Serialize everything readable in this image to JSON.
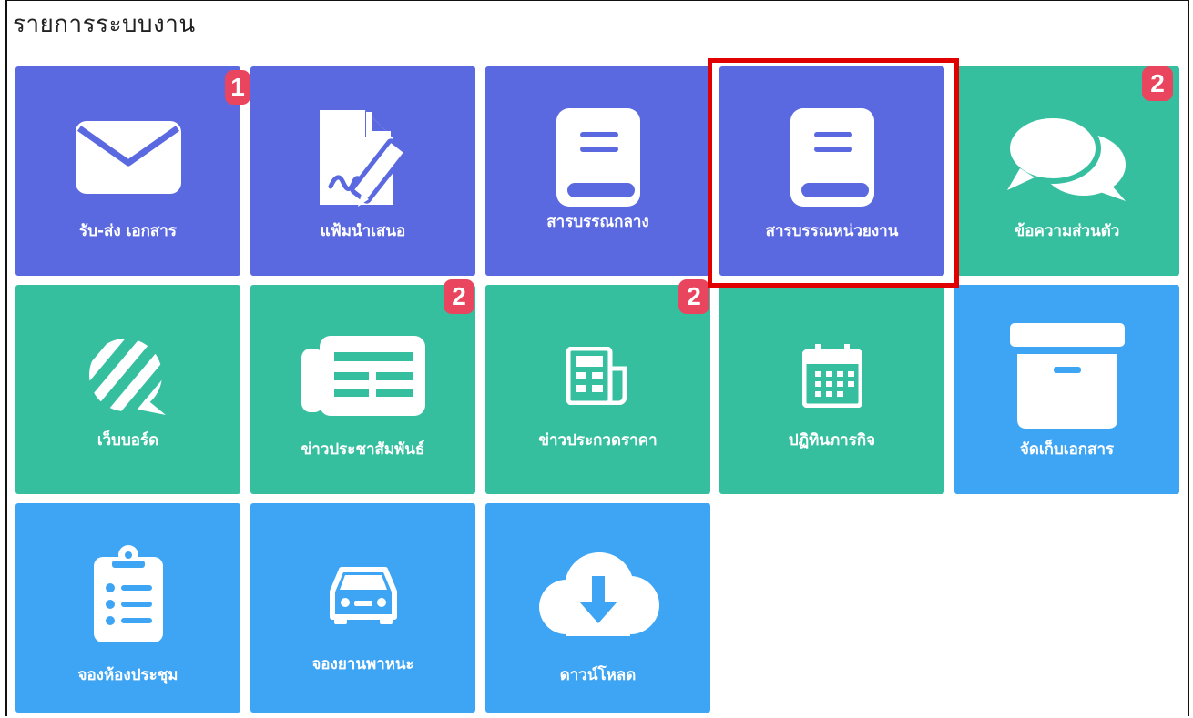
{
  "page": {
    "title": "รายการระบบงาน"
  },
  "colors": {
    "purple": "#5b69e0",
    "green": "#36bf9f",
    "blue": "#3ea5f5",
    "badge": "#e9455e",
    "highlight": "#e00000"
  },
  "tiles": [
    {
      "label": "รับ-ส่ง เอกสาร",
      "icon": "envelope-icon",
      "color": "purple",
      "badge": "1"
    },
    {
      "label": "แฟ้มนำเสนอ",
      "icon": "file-signature-icon",
      "color": "purple"
    },
    {
      "label": "สารบรรณกลาง",
      "icon": "book-icon",
      "color": "purple"
    },
    {
      "label": "สารบรรณหน่วยงาน",
      "icon": "book-icon",
      "color": "purple",
      "highlighted": true
    },
    {
      "label": "ข้อความส่วนตัว",
      "icon": "comments-icon",
      "color": "green",
      "badge": "2"
    },
    {
      "label": "เว็บบอร์ด",
      "icon": "webboard-icon",
      "color": "green"
    },
    {
      "label": "ข่าวประชาสัมพันธ์",
      "icon": "newspaper-icon",
      "color": "green",
      "badge": "2"
    },
    {
      "label": "ข่าวประกวดราคา",
      "icon": "newspaper-small-icon",
      "color": "green",
      "badge": "2"
    },
    {
      "label": "ปฏิทินภารกิจ",
      "icon": "calendar-icon",
      "color": "green"
    },
    {
      "label": "จัดเก็บเอกสาร",
      "icon": "archive-icon",
      "color": "blue"
    },
    {
      "label": "จองห้องประชุม",
      "icon": "clipboard-list-icon",
      "color": "blue"
    },
    {
      "label": "จองยานพาหนะ",
      "icon": "car-icon",
      "color": "blue"
    },
    {
      "label": "ดาวน์โหลด",
      "icon": "cloud-download-icon",
      "color": "blue"
    }
  ]
}
